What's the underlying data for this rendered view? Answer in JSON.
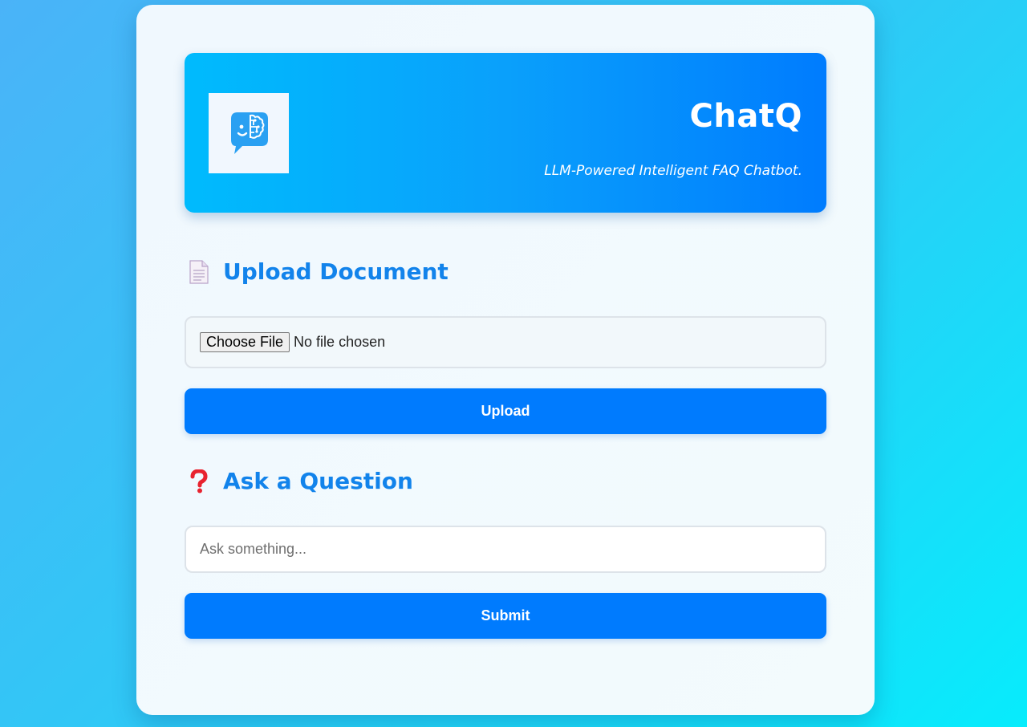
{
  "header": {
    "logo_icon": "brain-chat-bubble-icon",
    "title": "ChatQ",
    "subtitle": "LLM-Powered Intelligent FAQ Chatbot."
  },
  "upload": {
    "icon": "document-icon",
    "heading": "Upload Document",
    "choose_label": "Choose File",
    "file_status": "No file chosen",
    "button_label": "Upload"
  },
  "question": {
    "icon": "question-mark-icon",
    "heading": "Ask a Question",
    "placeholder": "Ask something...",
    "value": "",
    "button_label": "Submit"
  },
  "colors": {
    "accent": "#007bfe",
    "heading": "#1283eb",
    "hero_start": "#00bbfd",
    "hero_end": "#007cfe",
    "question_icon": "#e8232f"
  }
}
